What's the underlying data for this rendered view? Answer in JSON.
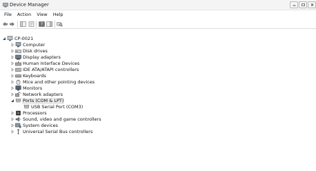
{
  "window": {
    "title": "Device Manager"
  },
  "menu": [
    "File",
    "Action",
    "View",
    "Help"
  ],
  "tree": {
    "root": "CP-0021",
    "categories": [
      {
        "label": "Computer",
        "icon": "computer-icon"
      },
      {
        "label": "Disk drives",
        "icon": "disk-drive-icon"
      },
      {
        "label": "Display adapters",
        "icon": "display-adapter-icon"
      },
      {
        "label": "Human Interface Devices",
        "icon": "hid-icon"
      },
      {
        "label": "IDE ATA/ATAPI controllers",
        "icon": "ide-controller-icon"
      },
      {
        "label": "Keyboards",
        "icon": "keyboard-icon"
      },
      {
        "label": "Mice and other pointing devices",
        "icon": "mouse-icon"
      },
      {
        "label": "Monitors",
        "icon": "monitor-icon"
      },
      {
        "label": "Network adapters",
        "icon": "network-adapter-icon"
      },
      {
        "label": "Ports (COM & LPT)",
        "icon": "port-icon",
        "expanded": true,
        "children": [
          "USB Serial Port (COM3)"
        ]
      },
      {
        "label": "Processors",
        "icon": "processor-icon"
      },
      {
        "label": "Sound, video and game controllers",
        "icon": "sound-icon"
      },
      {
        "label": "System devices",
        "icon": "system-device-icon"
      },
      {
        "label": "Universal Serial Bus controllers",
        "icon": "usb-icon"
      }
    ]
  }
}
